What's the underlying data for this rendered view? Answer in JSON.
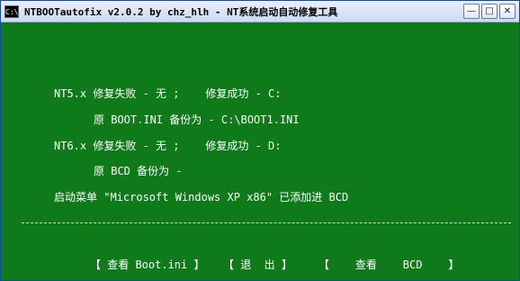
{
  "window": {
    "title": "NTBOOTautofix v2.0.2 by chz_hlh - NT系统启动自动修复工具",
    "icon_text": "C:\\"
  },
  "console": {
    "lines": [
      "NT5.x 修复失败 - 无 ;    修复成功 - C:",
      "原 BOOT.INI 备份为 - C:\\BOOT1.INI",
      "NT6.x 修复失败 - 无 ;    修复成功 - D:",
      "原 BCD 备份为 -",
      "启动菜单 \"Microsoft Windows XP x86\" 已添加进 BCD"
    ],
    "buttons": {
      "view_boot_ini": "【 查看 Boot.ini 】",
      "exit": "【 退  出 】",
      "view_bcd": "【    查看    BCD    】"
    }
  },
  "colors": {
    "console_bg": "#0f7a1a",
    "console_text": "#ffffff"
  }
}
